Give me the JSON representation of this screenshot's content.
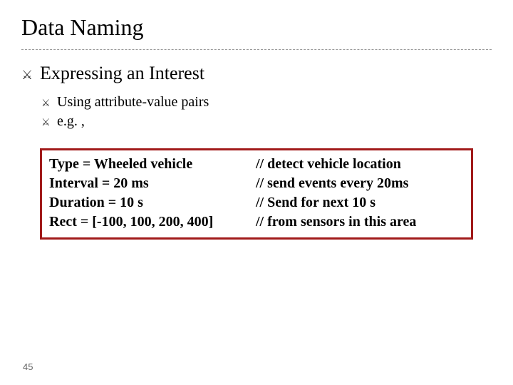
{
  "title": "Data Naming",
  "bullet_glyph": "⚔",
  "lvl1": "Expressing an Interest",
  "lvl2": [
    "Using attribute-value pairs",
    "e.g. ,"
  ],
  "code": [
    {
      "left": "Type = Wheeled vehicle",
      "right": "// detect vehicle location"
    },
    {
      "left": "Interval = 20 ms",
      "right": "// send events every 20ms"
    },
    {
      "left": "Duration = 10 s",
      "right": "// Send for next 10 s"
    },
    {
      "left": "Rect = [-100, 100, 200, 400]",
      "right": "// from sensors in this area"
    }
  ],
  "page_number": "45"
}
